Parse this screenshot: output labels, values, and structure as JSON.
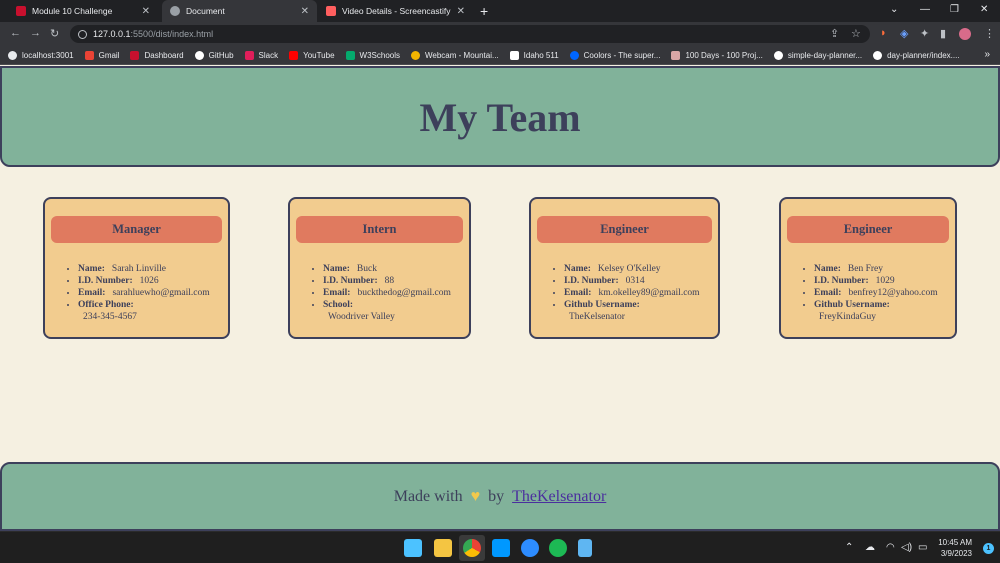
{
  "browser": {
    "tabs": [
      {
        "title": "Module 10 Challenge",
        "active": false,
        "color": "#c8102e"
      },
      {
        "title": "Document",
        "active": true,
        "color": "#9aa0a6"
      },
      {
        "title": "Video Details - Screencastify",
        "active": false,
        "color": "#ff5f5f"
      }
    ],
    "new_tab": "+",
    "address": {
      "host": "127.0.0.1",
      "rest": ":5500/dist/index.html"
    },
    "bookmarks": [
      {
        "label": "localhost:3001",
        "color": "#e8eaed"
      },
      {
        "label": "Gmail",
        "color": "#ea4335"
      },
      {
        "label": "Dashboard",
        "color": "#c8102e"
      },
      {
        "label": "GitHub",
        "color": "#ffffff"
      },
      {
        "label": "Slack",
        "color": "#e01e5a"
      },
      {
        "label": "YouTube",
        "color": "#ff0000"
      },
      {
        "label": "W3Schools",
        "color": "#04aa6d"
      },
      {
        "label": "Webcam - Mountai...",
        "color": "#f4b400"
      },
      {
        "label": "Idaho 511",
        "color": "#ffffff"
      },
      {
        "label": "Coolors - The super...",
        "color": "#0066ff"
      },
      {
        "label": "100 Days - 100 Proj...",
        "color": "#d9a6a6"
      },
      {
        "label": "simple-day-planner...",
        "color": "#ffffff"
      },
      {
        "label": "day-planner/index....",
        "color": "#ffffff"
      }
    ]
  },
  "page": {
    "title": "My Team",
    "cards": [
      {
        "role": "Manager",
        "name_label": "Name:",
        "name": "Sarah Linville",
        "id_label": "I.D. Number:",
        "id": "1026",
        "email_label": "Email:",
        "email": "sarahluewho@gmail.com",
        "extra_label": "Office Phone:",
        "extra": "234-345-4567"
      },
      {
        "role": "Intern",
        "name_label": "Name:",
        "name": "Buck",
        "id_label": "I.D. Number:",
        "id": "88",
        "email_label": "Email:",
        "email": "buckthedog@gmail.com",
        "extra_label": "School:",
        "extra": "Woodriver Valley"
      },
      {
        "role": "Engineer",
        "name_label": "Name:",
        "name": "Kelsey O'Kelley",
        "id_label": "I.D. Number:",
        "id": "0314",
        "email_label": "Email:",
        "email": "km.okelley89@gmail.com",
        "extra_label": "Github Username:",
        "extra": "TheKelsenator"
      },
      {
        "role": "Engineer",
        "name_label": "Name:",
        "name": "Ben Frey",
        "id_label": "I.D. Number:",
        "id": "1029",
        "email_label": "Email:",
        "email": "benfrey12@yahoo.com",
        "extra_label": "Github Username:",
        "extra": "FreyKindaGuy"
      }
    ],
    "footer": {
      "made_with": "Made with",
      "by": "by",
      "author": "TheKelsenator"
    }
  },
  "taskbar": {
    "apps": [
      {
        "name": "windows-start-icon",
        "color": "#4cc2ff"
      },
      {
        "name": "file-explorer-icon",
        "color": "#f4c542"
      },
      {
        "name": "chrome-icon",
        "color": "#34a853"
      },
      {
        "name": "vscode-icon",
        "color": "#0098ff"
      },
      {
        "name": "zoom-icon",
        "color": "#2d8cff"
      },
      {
        "name": "spotify-icon",
        "color": "#1db954"
      },
      {
        "name": "notepad-icon",
        "color": "#5fb6f2"
      }
    ],
    "time": "10:45 AM",
    "date": "3/9/2023",
    "notification_count": "1"
  },
  "colors": {
    "header_bg": "#81b29a",
    "page_bg": "#f5f0e1",
    "card_bg": "#f2cc8f",
    "role_bg": "#e07a5f",
    "text": "#3d405b",
    "link": "#4b2f9e"
  }
}
